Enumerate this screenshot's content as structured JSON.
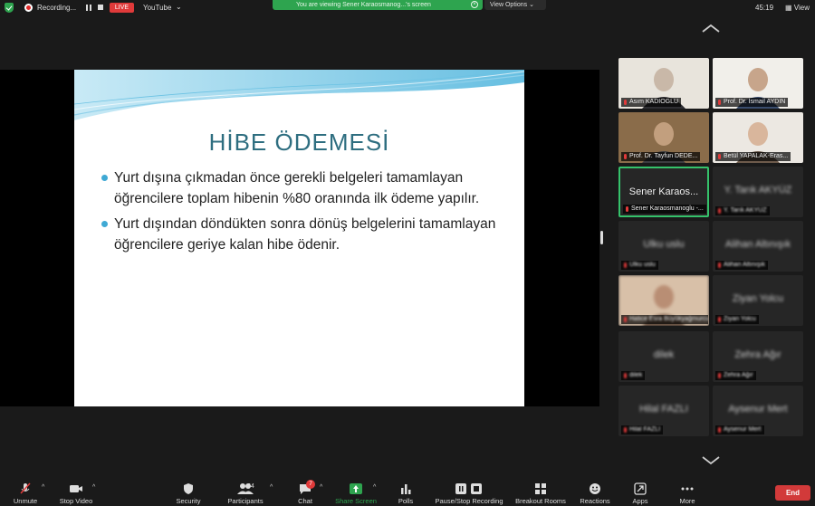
{
  "topbar": {
    "recording_label": "Recording...",
    "live_label": "LIVE",
    "youtube_label": "YouTube",
    "viewing_banner": "You are viewing Sener Karaosmanog...'s screen",
    "view_options_label": "View Options",
    "timer": "45:19",
    "view_label": "View"
  },
  "slide": {
    "title": "HİBE ÖDEMESİ",
    "bullets": [
      "Yurt dışına çıkmadan önce gerekli belgeleri tamamlayan öğrencilere toplam hibenin %80 oranında ilk ödeme yapılır.",
      "Yurt dışından döndükten sonra dönüş belgelerini tamamlayan öğrencilere geriye kalan hibe ödenir."
    ]
  },
  "gallery": {
    "tiles": [
      {
        "name": "Asım KADIOGLU"
      },
      {
        "name": "Prof. Dr. İsmail AYDIN"
      },
      {
        "name": "Prof. Dr. Tayfun DEDE..."
      },
      {
        "name": "Betül YAPALAK-Eras..."
      },
      {
        "name": "Sener Karaosmanoglu -...",
        "center": "Sener Karaos..."
      },
      {
        "name": "Y. Tarık AKYÜZ",
        "center": "Y. Tarık AKYÜZ"
      },
      {
        "name": "Ulku uslu",
        "center": "Ulku uslu"
      },
      {
        "name": "Alihan Altınışık",
        "center": "Alihan Altınışık"
      },
      {
        "name": "Hatice Esra Büyükyağmurcu"
      },
      {
        "name": "Ziyan Yolcu",
        "center": "Ziyan Yolcu"
      },
      {
        "name": "dilek",
        "center": "dilek"
      },
      {
        "name": "Zehra Ağır",
        "center": "Zehra Ağır"
      },
      {
        "name": "Hilal FAZLI",
        "center": "Hilal FAZLI"
      },
      {
        "name": "Aysenur Mert",
        "center": "Aysenur Mert"
      }
    ]
  },
  "toolbar": {
    "unmute": "Unmute",
    "stop_video": "Stop Video",
    "security": "Security",
    "participants": "Participants",
    "participants_count": "64",
    "chat": "Chat",
    "chat_badge": "7",
    "share_screen": "Share Screen",
    "polls": "Polls",
    "pause_stop_recording": "Pause/Stop Recording",
    "breakout_rooms": "Breakout Rooms",
    "reactions": "Reactions",
    "apps": "Apps",
    "more": "More",
    "end": "End"
  },
  "colors": {
    "accent_green": "#2ea44f",
    "end_red": "#d23a3a",
    "slide_title": "#2e6e80",
    "bullet_blue": "#3fa9d4"
  }
}
